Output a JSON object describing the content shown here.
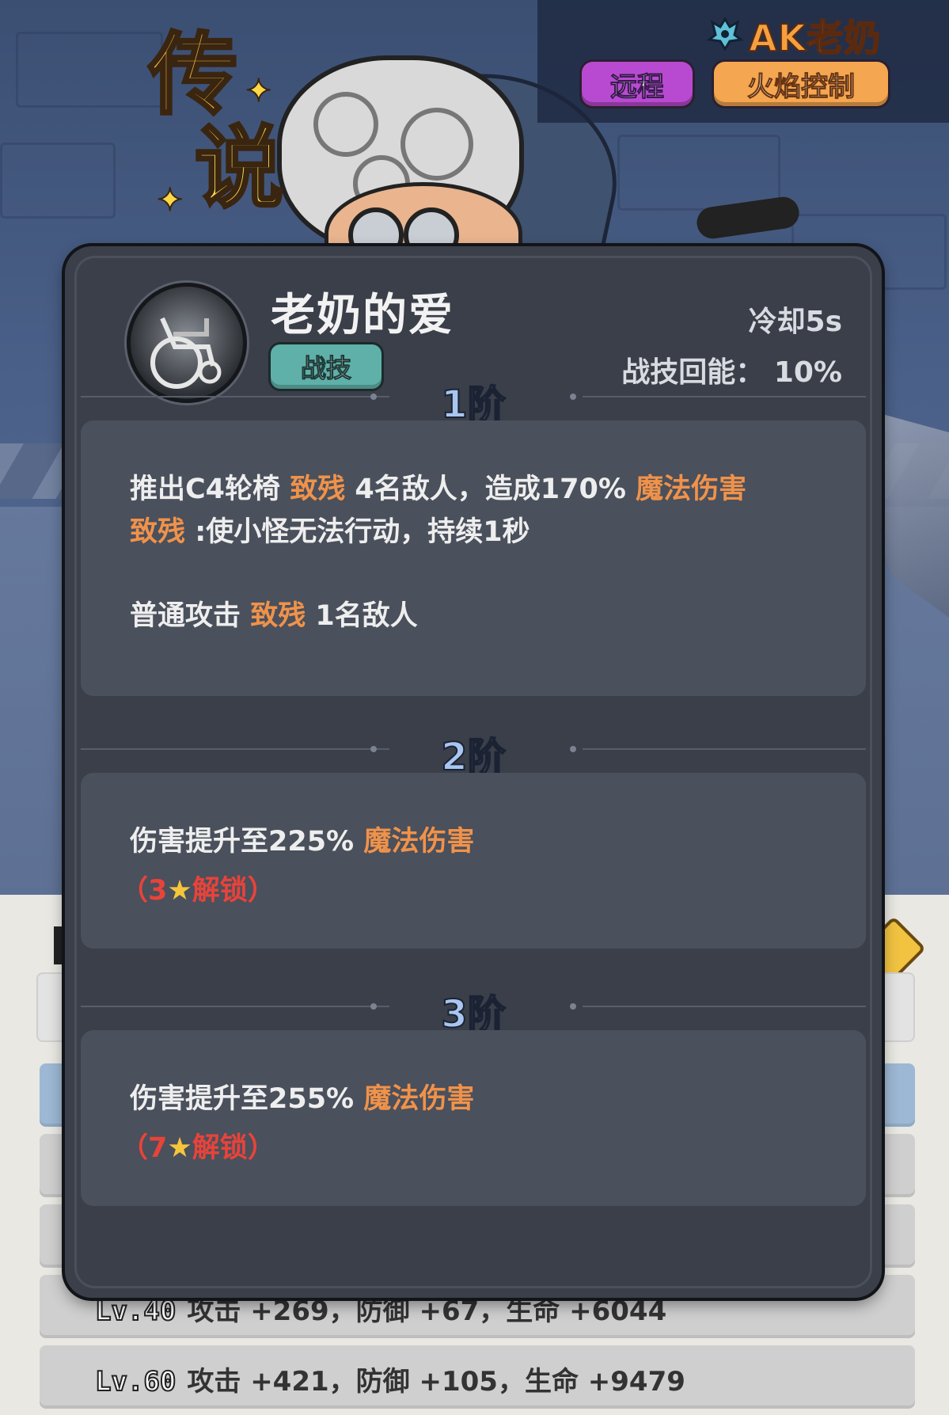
{
  "hero": {
    "rarity_char1": "传",
    "rarity_char2": "说",
    "name": "AK老奶",
    "tags": [
      "远程",
      "火焰控制"
    ]
  },
  "skill": {
    "name": "老奶的爱",
    "type_label": "战技",
    "cooldown": "冷却5s",
    "energy_regen": "战技回能：  10%"
  },
  "tiers": [
    {
      "label": "1阶",
      "lines": [
        {
          "a": "推出C4轮椅 ",
          "hl1": "致残",
          "b": " 4名敌人，造成170% ",
          "hl2": "魔法伤害"
        },
        {
          "hl1": "致残",
          "b": " :使小怪无法行动，持续1秒"
        },
        {
          "a": "普通攻击 ",
          "hl1": "致残",
          "b": " 1名敌人"
        }
      ]
    },
    {
      "label": "2阶",
      "line": {
        "a": "伤害提升至225% ",
        "hl": "魔法伤害"
      },
      "unlock": {
        "open": "（",
        "num": "3",
        "star": "★",
        "text": "解锁",
        "close": "）"
      }
    },
    {
      "label": "3阶",
      "line": {
        "a": "伤害提升至255% ",
        "hl": "魔法伤害"
      },
      "unlock": {
        "open": "（",
        "num": "7",
        "star": "★",
        "text": "解锁",
        "close": "）"
      }
    }
  ],
  "stats": [
    {
      "lv": "Lv.40",
      "text": "攻击 +269，防御 +67，生命 +6044"
    },
    {
      "lv": "Lv.60",
      "text": "攻击 +421，防御 +105，生命 +9479"
    }
  ],
  "colors": {
    "highlight": "#f0924a",
    "locked": "#e8433a",
    "tier_label": "#a8c6f0"
  }
}
